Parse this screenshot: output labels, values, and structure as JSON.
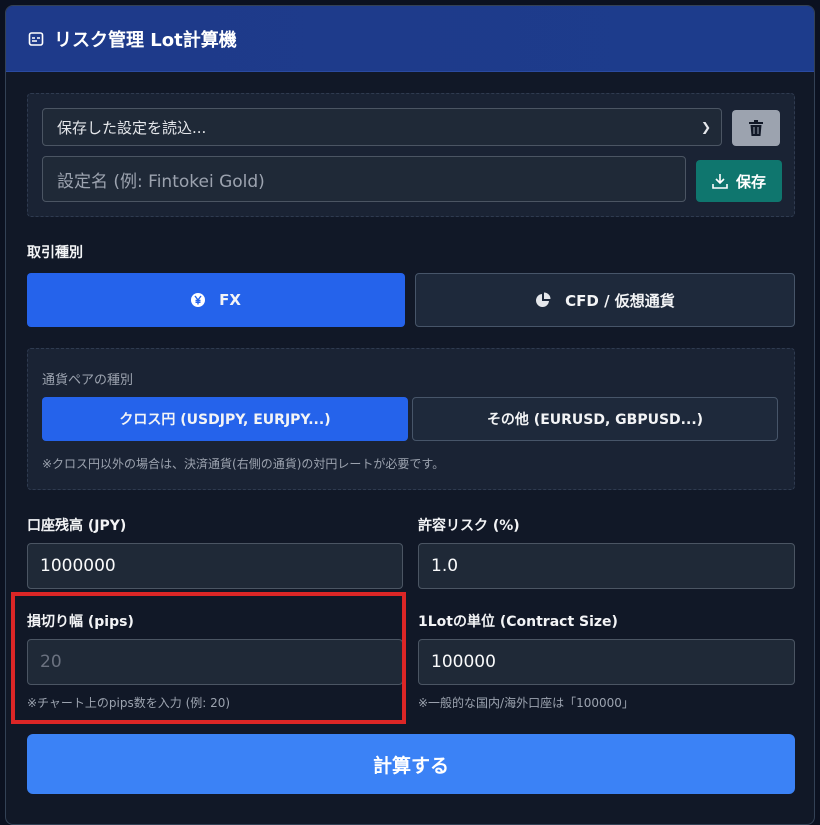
{
  "header": {
    "title": "リスク管理 Lot計算機",
    "icon": "calculator-icon"
  },
  "preset": {
    "select_value": "保存した設定を読込...",
    "name_placeholder": "設定名 (例: Fintokei Gold)",
    "save_label": "保存"
  },
  "trade_type": {
    "label": "取引種別",
    "options": [
      {
        "label": "FX",
        "icon": "yen-icon",
        "active": true
      },
      {
        "label": "CFD / 仮想通貨",
        "icon": "pie-chart-icon",
        "active": false
      }
    ]
  },
  "pair_type": {
    "label": "通貨ペアの種別",
    "options": [
      {
        "label": "クロス円 (USDJPY, EURJPY...)",
        "active": true
      },
      {
        "label": "その他 (EURUSD, GBPUSD...)",
        "active": false
      }
    ],
    "note": "※クロス円以外の場合は、決済通貨(右側の通貨)の対円レートが必要です。"
  },
  "fields": {
    "balance": {
      "label": "口座残高 (JPY)",
      "value": "1000000"
    },
    "risk": {
      "label": "許容リスク (%)",
      "value": "1.0"
    },
    "stop_loss": {
      "label": "損切り幅 (pips)",
      "placeholder": "20",
      "hint": "※チャート上のpips数を入力 (例: 20)"
    },
    "contract": {
      "label": "1Lotの単位 (Contract Size)",
      "value": "100000",
      "hint": "※一般的な国内/海外口座は「100000」"
    }
  },
  "calc_label": "計算する",
  "colors": {
    "header": "#1e3a8a",
    "primary": "#2563eb",
    "save": "#0f766e",
    "calc": "#3b82f6",
    "highlight": "#dc2626"
  }
}
